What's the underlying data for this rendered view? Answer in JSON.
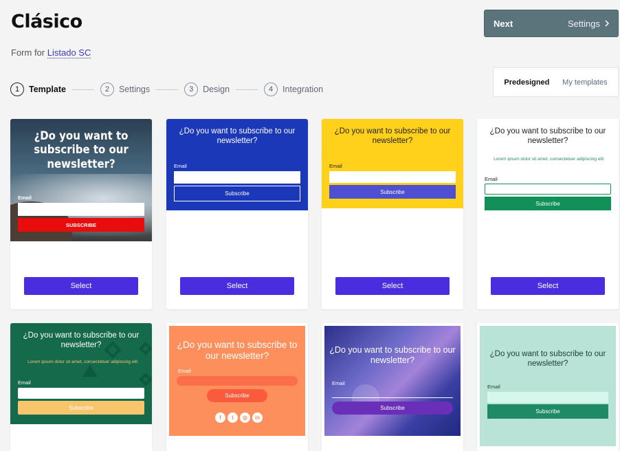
{
  "header": {
    "title": "Clásico",
    "form_for_label": "Form for",
    "form_for_link": "Listado SC",
    "next_label": "Next",
    "next_target": "Settings"
  },
  "steps": [
    {
      "num": "1",
      "label": "Template",
      "active": true
    },
    {
      "num": "2",
      "label": "Settings",
      "active": false
    },
    {
      "num": "3",
      "label": "Design",
      "active": false
    },
    {
      "num": "4",
      "label": "Integration",
      "active": false
    }
  ],
  "tabs": [
    {
      "label": "Predesigned",
      "active": true
    },
    {
      "label": "My templates",
      "active": false
    }
  ],
  "templates": {
    "question": "¿Do you want to subscribe to our newsletter?",
    "email_label": "Email",
    "subscribe_label": "Subscribe",
    "subscribe_upper": "SUBSCRIBE",
    "lorem": "Lorem ipsum dolor sit amet, consectetuer adipiscing elit.",
    "select_label": "Select",
    "social_icons": [
      "facebook-icon",
      "twitter-icon",
      "instagram-icon",
      "linkedin-icon"
    ]
  },
  "colors": {
    "select_button": "#4b2de0",
    "next_button": "#5b747c",
    "card2_bg": "#1a38b8",
    "card3_bg": "#ffd11a",
    "card4_button": "#12905a",
    "card5_bg": "#166a4c",
    "card6_bg": "#fc8f5c",
    "card8_bg": "#b9e3d6"
  }
}
